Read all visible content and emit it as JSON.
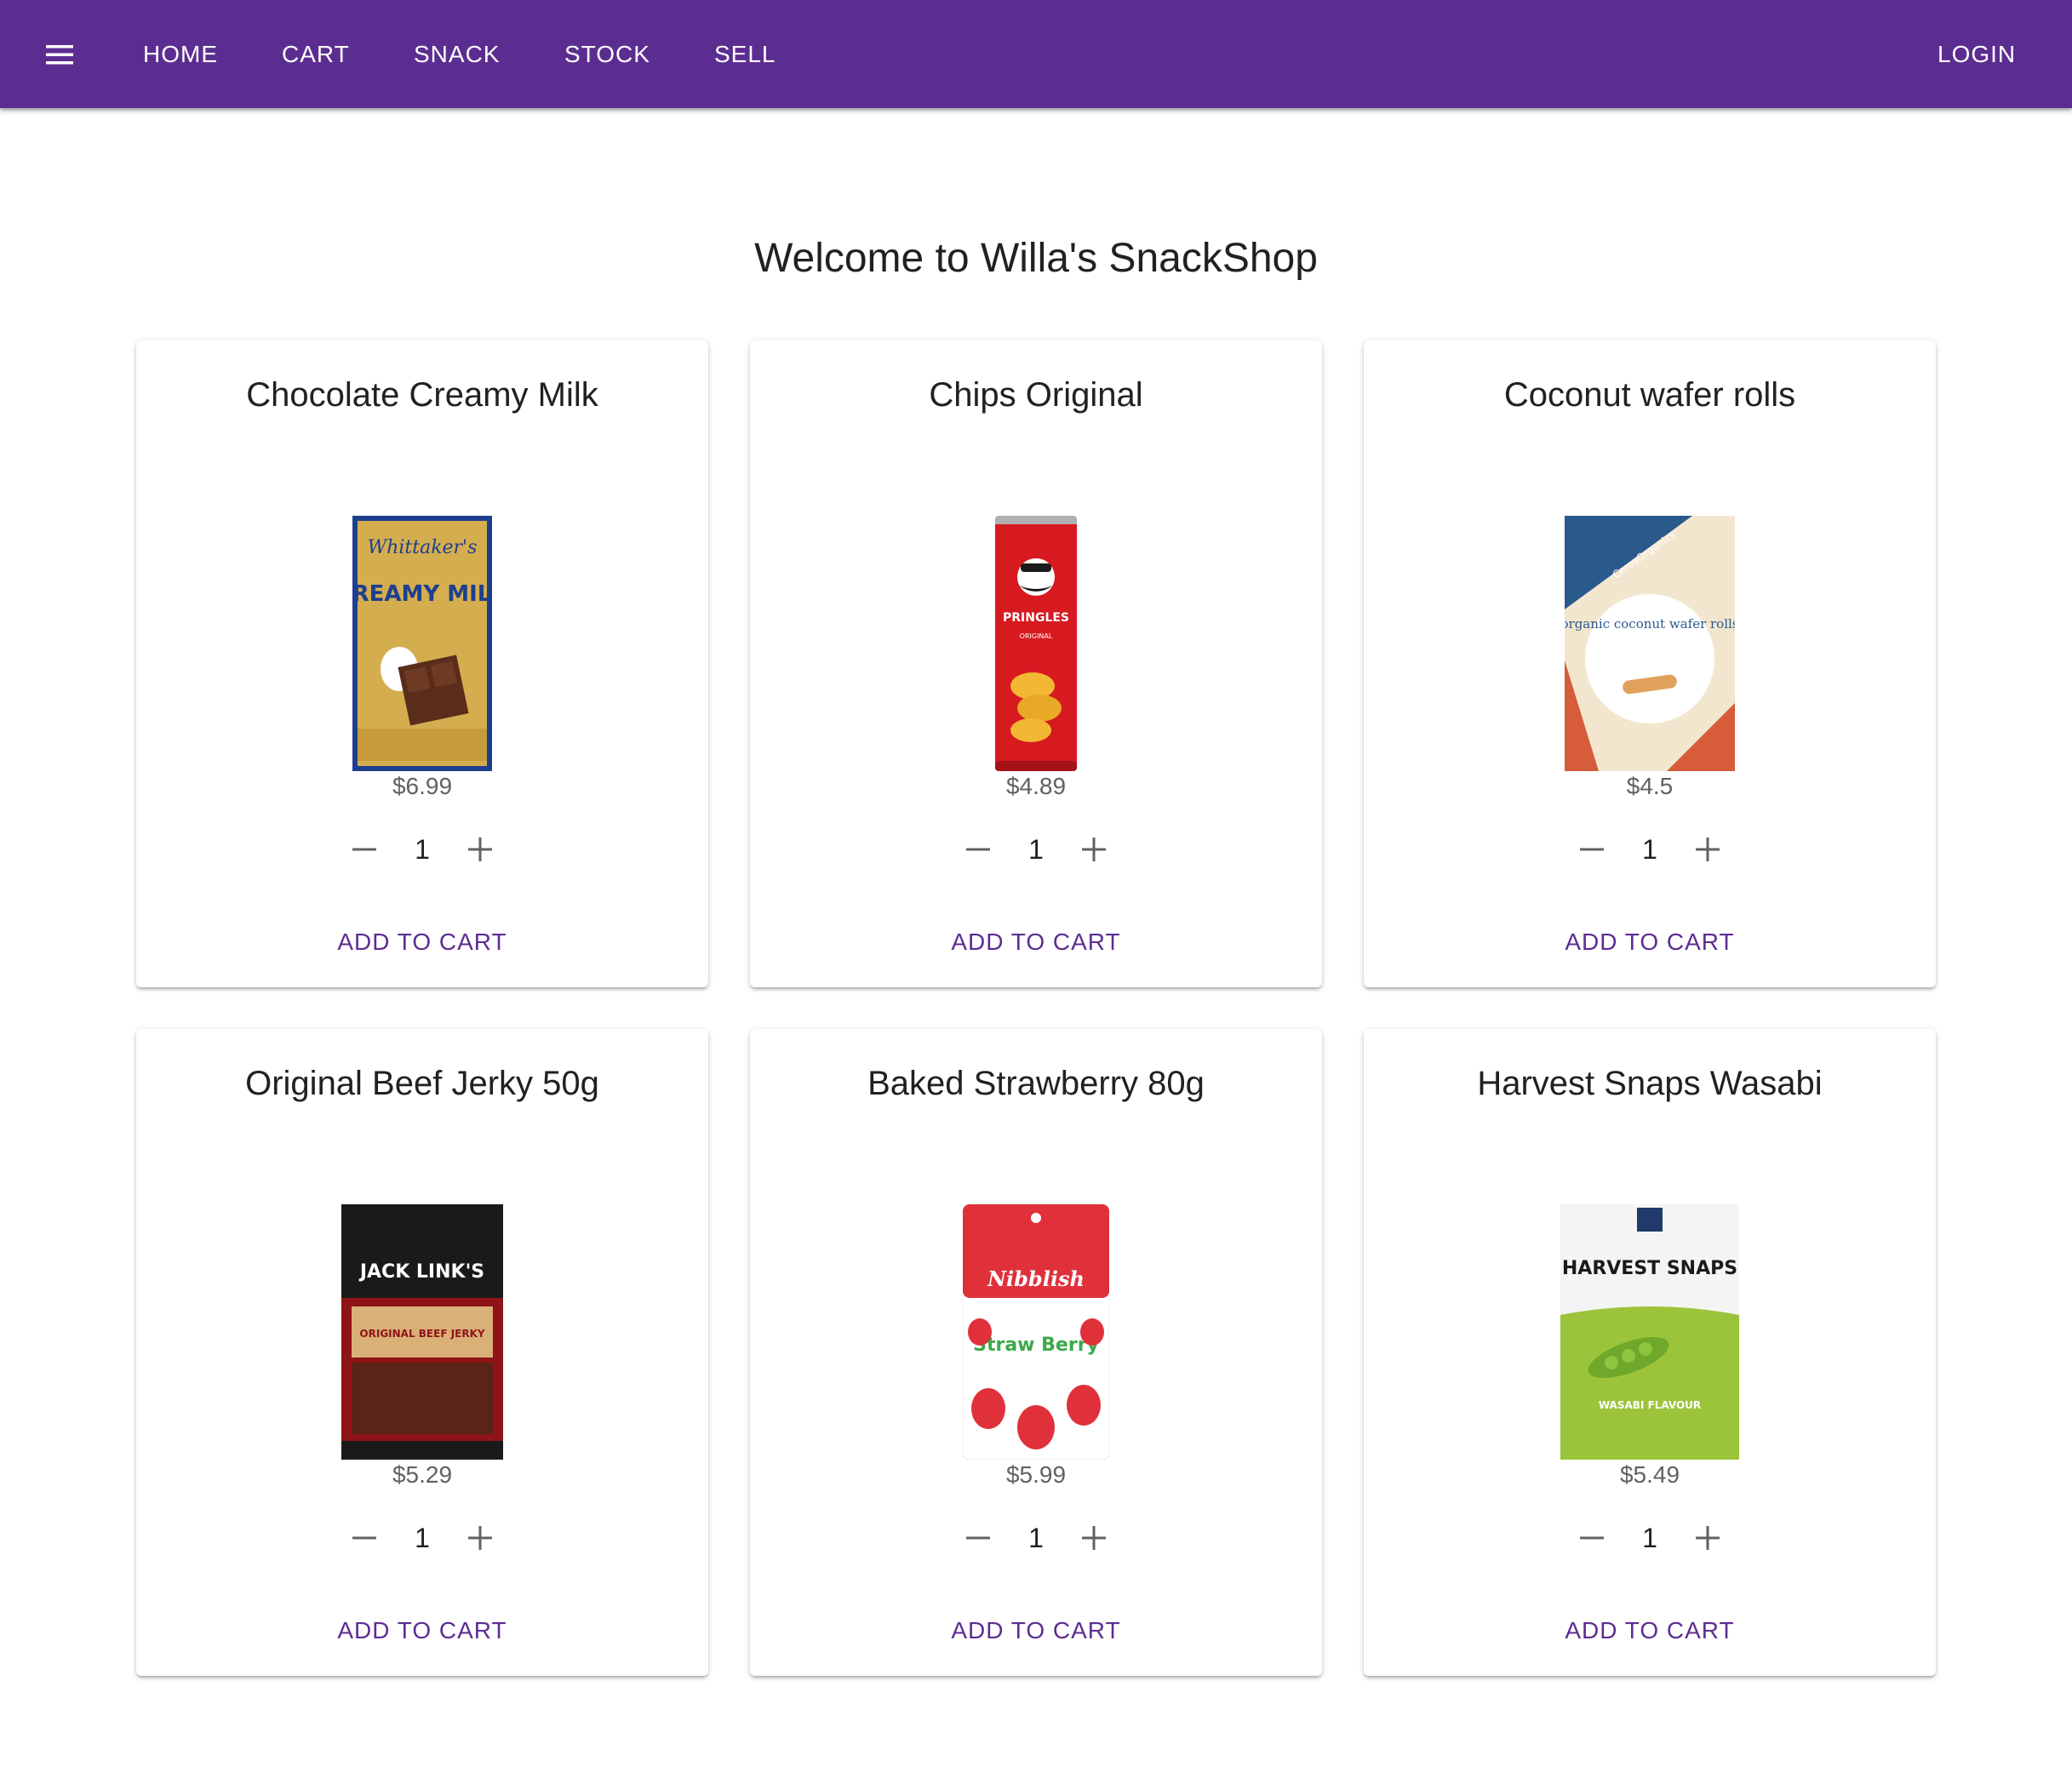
{
  "nav": {
    "menu_icon": "menu-icon",
    "links": [
      "HOME",
      "CART",
      "SNACK",
      "STOCK",
      "SELL"
    ],
    "login": "LOGIN",
    "bar_color": "#5c2d91"
  },
  "page": {
    "title": "Welcome to Willa's SnackShop"
  },
  "products": [
    {
      "name": "Chocolate Creamy Milk",
      "price": "$6.99",
      "quantity": "1",
      "button": "ADD TO CART",
      "image": "whittakers-creamy-milk-chocolate-bar",
      "brand_text": "Whittaker's",
      "pack_text": "CREAMY MILK"
    },
    {
      "name": "Chips Original",
      "price": "$4.89",
      "quantity": "1",
      "button": "ADD TO CART",
      "image": "pringles-original-can",
      "brand_text": "PRINGLES",
      "pack_text": "ORIGINAL"
    },
    {
      "name": "Coconut wafer rolls",
      "price": "$4.5",
      "quantity": "1",
      "button": "ADD TO CART",
      "image": "ceres-organics-coconut-wafer-rolls-box",
      "brand_text": "CeresOrganics",
      "pack_text": "organic coconut wafer rolls"
    },
    {
      "name": "Original Beef Jerky 50g",
      "price": "$5.29",
      "quantity": "1",
      "button": "ADD TO CART",
      "image": "jack-links-beef-jerky-bag",
      "brand_text": "JACK LINK'S",
      "pack_text": "ORIGINAL BEEF JERKY"
    },
    {
      "name": "Baked Strawberry 80g",
      "price": "$5.99",
      "quantity": "1",
      "button": "ADD TO CART",
      "image": "nibblish-strawberry-pouch",
      "brand_text": "Nibblish",
      "pack_text": "Straw Berry"
    },
    {
      "name": "Harvest Snaps Wasabi",
      "price": "$5.49",
      "quantity": "1",
      "button": "ADD TO CART",
      "image": "harvest-snaps-wasabi-bag",
      "brand_text": "HARVEST SNAPS",
      "pack_text": "WASABI FLAVOUR"
    }
  ],
  "icons": {
    "decrement": "minus-icon",
    "increment": "plus-icon"
  },
  "colors": {
    "accent": "#5c2d91",
    "price": "#616161",
    "text": "#212121"
  }
}
